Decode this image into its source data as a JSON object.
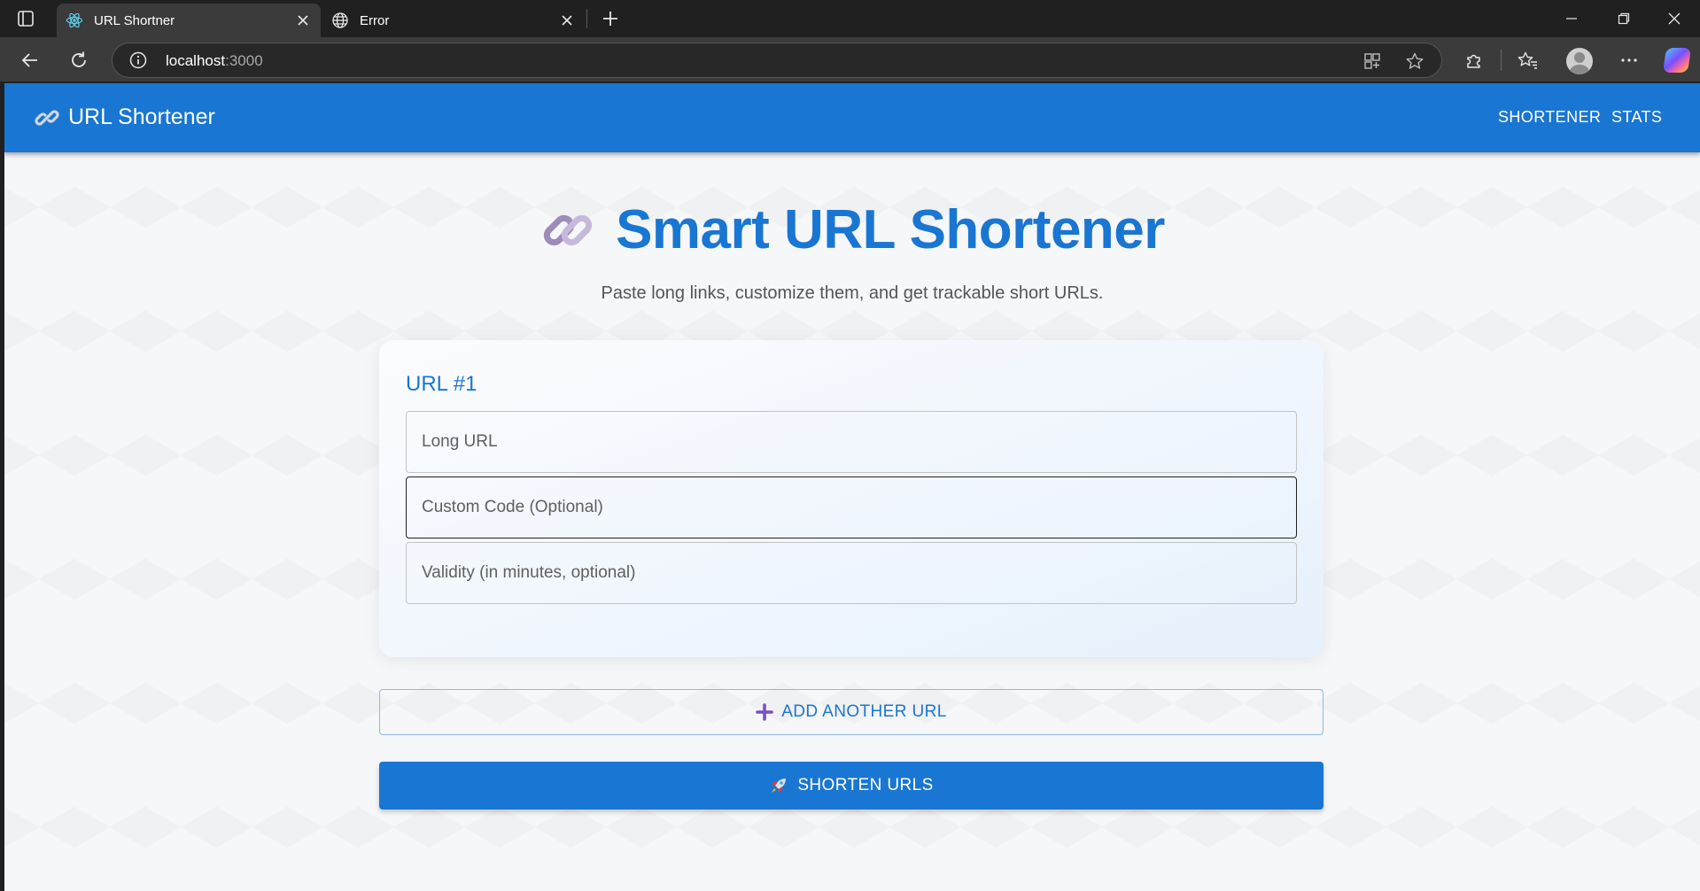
{
  "browser": {
    "tabs": [
      {
        "title": "URL Shortner",
        "active": true,
        "favicon": "react-icon"
      },
      {
        "title": "Error",
        "active": false,
        "favicon": "globe-icon"
      }
    ],
    "address": {
      "host": "localhost",
      "port": ":3000"
    }
  },
  "app": {
    "brand": "URL Shortener",
    "brand_icon": "link-icon",
    "nav": [
      "SHORTENER",
      "STATS"
    ],
    "accent_color": "#1976d2"
  },
  "hero": {
    "title": "Smart URL Shortener",
    "subtitle": "Paste long links, customize them, and get trackable short URLs."
  },
  "form": {
    "card_title": "URL #1",
    "fields": [
      {
        "placeholder": "Long URL",
        "value": ""
      },
      {
        "placeholder": "Custom Code (Optional)",
        "value": ""
      },
      {
        "placeholder": "Validity (in minutes, optional)",
        "value": ""
      }
    ],
    "add_button": "ADD ANOTHER URL",
    "submit_button": "SHORTEN URLS"
  }
}
